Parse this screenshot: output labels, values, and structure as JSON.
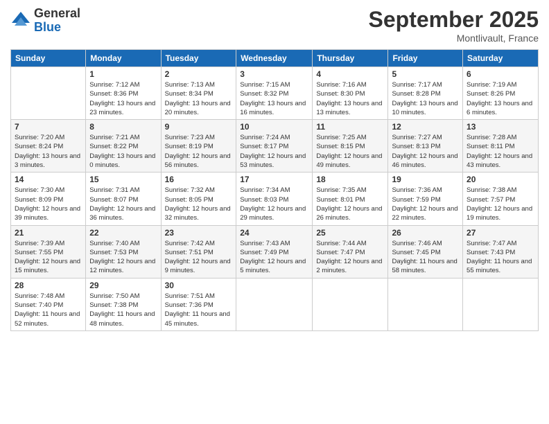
{
  "logo": {
    "general": "General",
    "blue": "Blue"
  },
  "header": {
    "title": "September 2025",
    "subtitle": "Montlivault, France"
  },
  "days_of_week": [
    "Sunday",
    "Monday",
    "Tuesday",
    "Wednesday",
    "Thursday",
    "Friday",
    "Saturday"
  ],
  "weeks": [
    [
      {
        "day": "",
        "sunrise": "",
        "sunset": "",
        "daylight": ""
      },
      {
        "day": "1",
        "sunrise": "Sunrise: 7:12 AM",
        "sunset": "Sunset: 8:36 PM",
        "daylight": "Daylight: 13 hours and 23 minutes."
      },
      {
        "day": "2",
        "sunrise": "Sunrise: 7:13 AM",
        "sunset": "Sunset: 8:34 PM",
        "daylight": "Daylight: 13 hours and 20 minutes."
      },
      {
        "day": "3",
        "sunrise": "Sunrise: 7:15 AM",
        "sunset": "Sunset: 8:32 PM",
        "daylight": "Daylight: 13 hours and 16 minutes."
      },
      {
        "day": "4",
        "sunrise": "Sunrise: 7:16 AM",
        "sunset": "Sunset: 8:30 PM",
        "daylight": "Daylight: 13 hours and 13 minutes."
      },
      {
        "day": "5",
        "sunrise": "Sunrise: 7:17 AM",
        "sunset": "Sunset: 8:28 PM",
        "daylight": "Daylight: 13 hours and 10 minutes."
      },
      {
        "day": "6",
        "sunrise": "Sunrise: 7:19 AM",
        "sunset": "Sunset: 8:26 PM",
        "daylight": "Daylight: 13 hours and 6 minutes."
      }
    ],
    [
      {
        "day": "7",
        "sunrise": "Sunrise: 7:20 AM",
        "sunset": "Sunset: 8:24 PM",
        "daylight": "Daylight: 13 hours and 3 minutes."
      },
      {
        "day": "8",
        "sunrise": "Sunrise: 7:21 AM",
        "sunset": "Sunset: 8:22 PM",
        "daylight": "Daylight: 13 hours and 0 minutes."
      },
      {
        "day": "9",
        "sunrise": "Sunrise: 7:23 AM",
        "sunset": "Sunset: 8:19 PM",
        "daylight": "Daylight: 12 hours and 56 minutes."
      },
      {
        "day": "10",
        "sunrise": "Sunrise: 7:24 AM",
        "sunset": "Sunset: 8:17 PM",
        "daylight": "Daylight: 12 hours and 53 minutes."
      },
      {
        "day": "11",
        "sunrise": "Sunrise: 7:25 AM",
        "sunset": "Sunset: 8:15 PM",
        "daylight": "Daylight: 12 hours and 49 minutes."
      },
      {
        "day": "12",
        "sunrise": "Sunrise: 7:27 AM",
        "sunset": "Sunset: 8:13 PM",
        "daylight": "Daylight: 12 hours and 46 minutes."
      },
      {
        "day": "13",
        "sunrise": "Sunrise: 7:28 AM",
        "sunset": "Sunset: 8:11 PM",
        "daylight": "Daylight: 12 hours and 43 minutes."
      }
    ],
    [
      {
        "day": "14",
        "sunrise": "Sunrise: 7:30 AM",
        "sunset": "Sunset: 8:09 PM",
        "daylight": "Daylight: 12 hours and 39 minutes."
      },
      {
        "day": "15",
        "sunrise": "Sunrise: 7:31 AM",
        "sunset": "Sunset: 8:07 PM",
        "daylight": "Daylight: 12 hours and 36 minutes."
      },
      {
        "day": "16",
        "sunrise": "Sunrise: 7:32 AM",
        "sunset": "Sunset: 8:05 PM",
        "daylight": "Daylight: 12 hours and 32 minutes."
      },
      {
        "day": "17",
        "sunrise": "Sunrise: 7:34 AM",
        "sunset": "Sunset: 8:03 PM",
        "daylight": "Daylight: 12 hours and 29 minutes."
      },
      {
        "day": "18",
        "sunrise": "Sunrise: 7:35 AM",
        "sunset": "Sunset: 8:01 PM",
        "daylight": "Daylight: 12 hours and 26 minutes."
      },
      {
        "day": "19",
        "sunrise": "Sunrise: 7:36 AM",
        "sunset": "Sunset: 7:59 PM",
        "daylight": "Daylight: 12 hours and 22 minutes."
      },
      {
        "day": "20",
        "sunrise": "Sunrise: 7:38 AM",
        "sunset": "Sunset: 7:57 PM",
        "daylight": "Daylight: 12 hours and 19 minutes."
      }
    ],
    [
      {
        "day": "21",
        "sunrise": "Sunrise: 7:39 AM",
        "sunset": "Sunset: 7:55 PM",
        "daylight": "Daylight: 12 hours and 15 minutes."
      },
      {
        "day": "22",
        "sunrise": "Sunrise: 7:40 AM",
        "sunset": "Sunset: 7:53 PM",
        "daylight": "Daylight: 12 hours and 12 minutes."
      },
      {
        "day": "23",
        "sunrise": "Sunrise: 7:42 AM",
        "sunset": "Sunset: 7:51 PM",
        "daylight": "Daylight: 12 hours and 9 minutes."
      },
      {
        "day": "24",
        "sunrise": "Sunrise: 7:43 AM",
        "sunset": "Sunset: 7:49 PM",
        "daylight": "Daylight: 12 hours and 5 minutes."
      },
      {
        "day": "25",
        "sunrise": "Sunrise: 7:44 AM",
        "sunset": "Sunset: 7:47 PM",
        "daylight": "Daylight: 12 hours and 2 minutes."
      },
      {
        "day": "26",
        "sunrise": "Sunrise: 7:46 AM",
        "sunset": "Sunset: 7:45 PM",
        "daylight": "Daylight: 11 hours and 58 minutes."
      },
      {
        "day": "27",
        "sunrise": "Sunrise: 7:47 AM",
        "sunset": "Sunset: 7:43 PM",
        "daylight": "Daylight: 11 hours and 55 minutes."
      }
    ],
    [
      {
        "day": "28",
        "sunrise": "Sunrise: 7:48 AM",
        "sunset": "Sunset: 7:40 PM",
        "daylight": "Daylight: 11 hours and 52 minutes."
      },
      {
        "day": "29",
        "sunrise": "Sunrise: 7:50 AM",
        "sunset": "Sunset: 7:38 PM",
        "daylight": "Daylight: 11 hours and 48 minutes."
      },
      {
        "day": "30",
        "sunrise": "Sunrise: 7:51 AM",
        "sunset": "Sunset: 7:36 PM",
        "daylight": "Daylight: 11 hours and 45 minutes."
      },
      {
        "day": "",
        "sunrise": "",
        "sunset": "",
        "daylight": ""
      },
      {
        "day": "",
        "sunrise": "",
        "sunset": "",
        "daylight": ""
      },
      {
        "day": "",
        "sunrise": "",
        "sunset": "",
        "daylight": ""
      },
      {
        "day": "",
        "sunrise": "",
        "sunset": "",
        "daylight": ""
      }
    ]
  ]
}
